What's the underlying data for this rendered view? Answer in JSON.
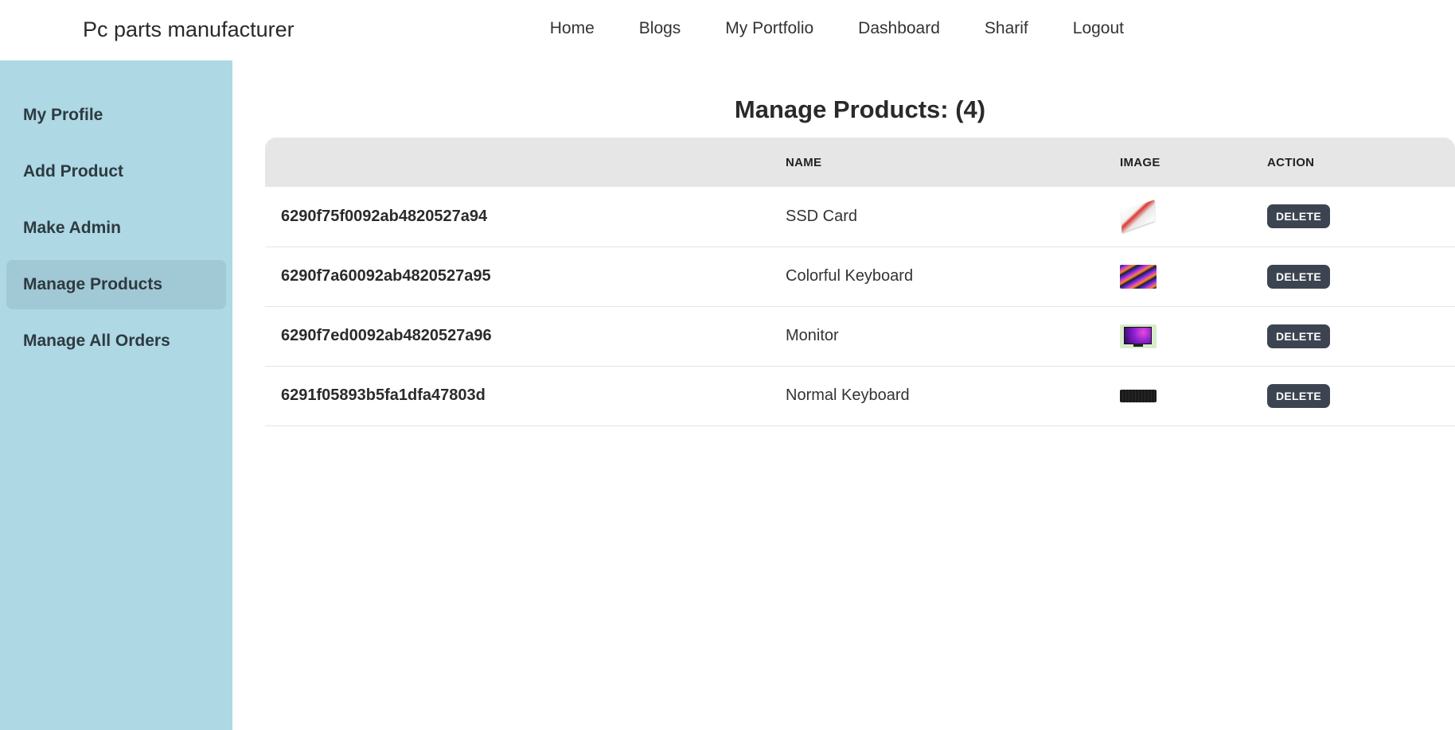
{
  "header": {
    "brand": "Pc parts manufacturer",
    "nav": [
      "Home",
      "Blogs",
      "My Portfolio",
      "Dashboard",
      "Sharif",
      "Logout"
    ]
  },
  "sidebar": {
    "items": [
      {
        "label": "My Profile",
        "active": false
      },
      {
        "label": "Add Product",
        "active": false
      },
      {
        "label": "Make Admin",
        "active": false
      },
      {
        "label": "Manage Products",
        "active": true
      },
      {
        "label": "Manage All Orders",
        "active": false
      }
    ]
  },
  "main": {
    "title": "Manage Products: (4)",
    "table": {
      "headers": [
        "",
        "NAME",
        "IMAGE",
        "ACTION"
      ],
      "rows": [
        {
          "id": "6290f75f0092ab4820527a94",
          "name": "SSD Card",
          "image": "ssd-card-image",
          "action": "DELETE"
        },
        {
          "id": "6290f7a60092ab4820527a95",
          "name": "Colorful Keyboard",
          "image": "colorful-keyboard-image",
          "action": "DELETE"
        },
        {
          "id": "6290f7ed0092ab4820527a96",
          "name": "Monitor",
          "image": "monitor-image",
          "action": "DELETE"
        },
        {
          "id": "6291f05893b5fa1dfa47803d",
          "name": "Normal Keyboard",
          "image": "normal-keyboard-image",
          "action": "DELETE"
        }
      ]
    }
  },
  "colors": {
    "sidebar_bg": "#add8e4",
    "sidebar_active": "#a1c8d5",
    "table_header_bg": "#e6e6e6",
    "delete_button": "#3d4451"
  }
}
